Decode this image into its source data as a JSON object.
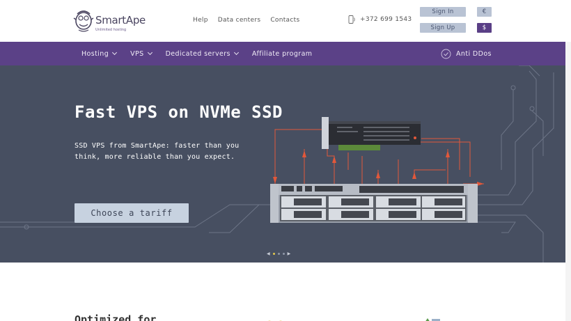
{
  "header": {
    "logo_name": "SmartApe",
    "logo_tagline": "Unlimited hosting",
    "links": [
      "Help",
      "Data centers",
      "Contacts"
    ],
    "phone": "+372 699 1543",
    "sign_in": "Sign In",
    "sign_up": "Sign Up",
    "currency_eur": "€",
    "currency_usd": "$"
  },
  "nav": {
    "items": [
      {
        "label": "Hosting",
        "dropdown": true
      },
      {
        "label": "VPS",
        "dropdown": true
      },
      {
        "label": "Dedicated servers",
        "dropdown": true
      },
      {
        "label": "Affiliate program",
        "dropdown": false
      }
    ],
    "anti_ddos": "Anti DDos"
  },
  "hero": {
    "title": "Fast VPS on NVMe SSD",
    "subtitle": "SSD VPS from SmartApe: faster than you think, more reliable than you expect.",
    "cta": "Choose a tariff",
    "slides_count": 3,
    "active_slide": 1
  },
  "section": {
    "title": "Optimized for"
  },
  "colors": {
    "purple": "#5b4187",
    "hero_bg": "#474f61",
    "accent_orange": "#e2583a",
    "button_light": "#c7d2e0"
  }
}
